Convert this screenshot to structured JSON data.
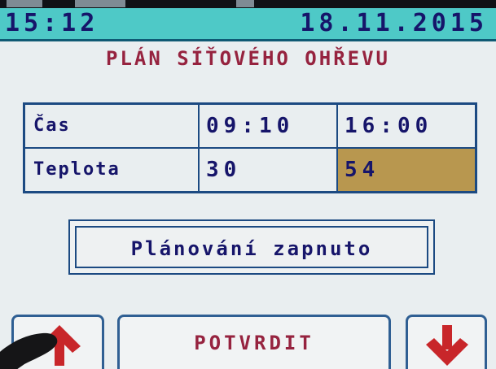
{
  "status": {
    "time": "15:12",
    "date": "18.11.2015"
  },
  "title": "PLÁN SÍŤOVÉHO OHŘEVU",
  "schedule": {
    "rows": [
      {
        "label": "Čas",
        "values": [
          "09:10",
          "16:00"
        ]
      },
      {
        "label": "Teplota",
        "values": [
          "30",
          "54"
        ]
      }
    ],
    "highlight_color": "#b8974f"
  },
  "mode": {
    "label": "Plánování zapnuto"
  },
  "buttons": {
    "up_icon": "arrow-up-icon",
    "confirm_label": "POTVRDIT",
    "down_icon": "arrow-down-icon"
  },
  "colors": {
    "status_bar": "#4ec9c7",
    "text_dark": "#16156a",
    "text_accent": "#96233f",
    "border": "#1c4a82"
  }
}
